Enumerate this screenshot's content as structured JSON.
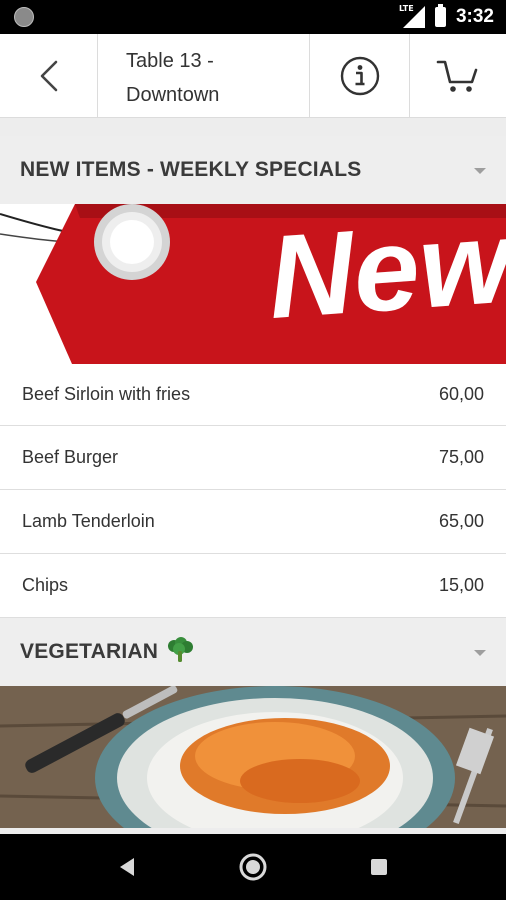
{
  "status_bar": {
    "time": "3:32",
    "network": "LTE",
    "icons": [
      "notification-dot-icon",
      "signal-icon",
      "battery-icon"
    ]
  },
  "app_bar": {
    "back_icon": "chevron-left-icon",
    "title_line1": "Table 13 -",
    "title_line2": "Downtown",
    "info_icon": "info-icon",
    "cart_icon": "cart-icon"
  },
  "sections": [
    {
      "title": "NEW ITEMS - WEEKLY SPECIALS",
      "banner_text": "New",
      "items": [
        {
          "name": "Beef Sirloin with fries",
          "price": "60,00"
        },
        {
          "name": "Beef Burger",
          "price": "75,00"
        },
        {
          "name": "Lamb Tenderloin",
          "price": "65,00"
        },
        {
          "name": "Chips",
          "price": "15,00"
        }
      ]
    },
    {
      "title": "VEGETARIAN",
      "title_icon": "broccoli-icon"
    }
  ],
  "nav_bar": {
    "icons": [
      "back-triangle-icon",
      "home-circle-icon",
      "recents-square-icon"
    ]
  },
  "colors": {
    "banner_red": "#c8141b",
    "header_bg": "#eeeeee",
    "status_bar": "#000000"
  }
}
